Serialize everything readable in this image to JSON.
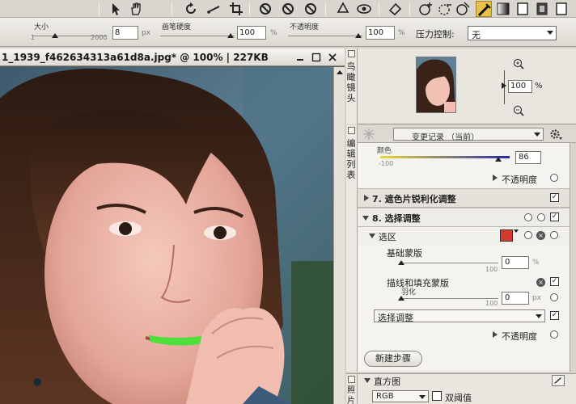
{
  "options_bar": {
    "size_label": "大小",
    "size_min": "1",
    "size_max": "2000",
    "size_value": "8",
    "size_unit": "px",
    "hardness_label": "画笔硬度",
    "hardness_value": "100",
    "hardness_unit": "%",
    "opacity_label": "不透明度",
    "opacity_value": "100",
    "opacity_unit": "%",
    "pressure_label": "压力控制:",
    "pressure_value": "无"
  },
  "document": {
    "title": "1_1939_f462634313a61d8a.jpg* @ 100% | 227KB"
  },
  "navigator": {
    "tab_label": "鸟瞰镜头",
    "zoom_value": "100",
    "zoom_unit": "%"
  },
  "history": {
    "side_tab_label": "编辑列表",
    "header": "变更记录 （当前）",
    "rows": {
      "color_label": "颜色",
      "color_min": "-100",
      "color_value": "86",
      "opacity1": "不透明度",
      "step7": "7. 遮色片锐利化调整",
      "step8": "8. 选择调整",
      "selection": "选区",
      "base_mask": "基础蒙版",
      "base_max": "100",
      "base_value": "0",
      "base_unit": "%",
      "stroke_mask": "描线和填充蒙版",
      "feather": "羽化",
      "feather_max": "100",
      "feather_value": "0",
      "feather_unit": "px",
      "adjust_select": "选择调整",
      "opacity2": "不透明度"
    },
    "new_step": "新建步骤"
  },
  "histogram": {
    "title": "直方图",
    "side_tab_label": "照片",
    "channel": "RGB",
    "threshold_label": "双阈值"
  }
}
